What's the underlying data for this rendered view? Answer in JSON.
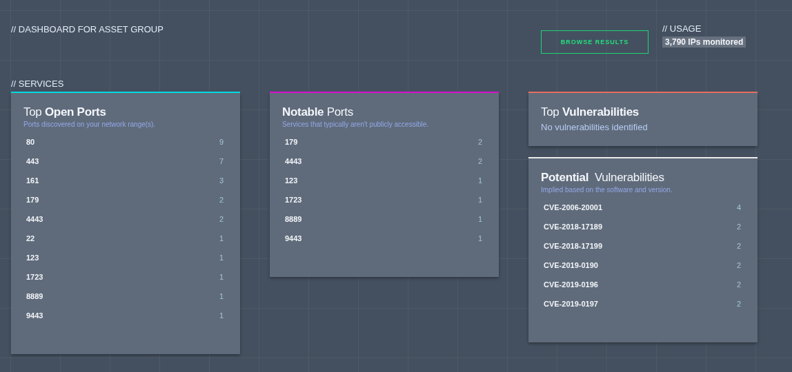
{
  "page_title": "// DASHBOARD FOR ASSET GROUP",
  "browse_button": "BROWSE RESULTS",
  "usage": {
    "label": "// USAGE",
    "value": "3,790 IPs monitored"
  },
  "section_label": "// SERVICES",
  "columns": [
    [
      {
        "kind": "list",
        "color": "#00e0e8",
        "title": "Top **Open Ports**",
        "subtitle": "Ports discovered on your network range(s).",
        "rows": [
          {
            "name": "80",
            "count": "9"
          },
          {
            "name": "443",
            "count": "7"
          },
          {
            "name": "161",
            "count": "3"
          },
          {
            "name": "179",
            "count": "2"
          },
          {
            "name": "4443",
            "count": "2"
          },
          {
            "name": "22",
            "count": "1"
          },
          {
            "name": "123",
            "count": "1"
          },
          {
            "name": "1723",
            "count": "1"
          },
          {
            "name": "8889",
            "count": "1"
          },
          {
            "name": "9443",
            "count": "1"
          }
        ]
      }
    ],
    [
      {
        "kind": "list",
        "color": "#e010d8",
        "title": "**Notable** Ports",
        "subtitle": "Services that typically aren't publicly accessible.",
        "rows": [
          {
            "name": "179",
            "count": "2"
          },
          {
            "name": "4443",
            "count": "2"
          },
          {
            "name": "123",
            "count": "1"
          },
          {
            "name": "1723",
            "count": "1"
          },
          {
            "name": "8889",
            "count": "1"
          },
          {
            "name": "9443",
            "count": "1"
          }
        ]
      }
    ],
    [
      {
        "kind": "message",
        "color": "#f07064",
        "title": "Top **Vulnerabilities**",
        "message": "No vulnerabilities identified"
      },
      {
        "kind": "list",
        "color": "#f2f2f2",
        "title": "**Potential**  Vulnerabilities",
        "subtitle": "Implied based on the software and version.",
        "rows": [
          {
            "name": "CVE-2006-20001",
            "count": "4"
          },
          {
            "name": "CVE-2018-17189",
            "count": "2"
          },
          {
            "name": "CVE-2018-17199",
            "count": "2"
          },
          {
            "name": "CVE-2019-0190",
            "count": "2"
          },
          {
            "name": "CVE-2019-0196",
            "count": "2"
          },
          {
            "name": "CVE-2019-0197",
            "count": "2"
          }
        ]
      }
    ]
  ]
}
